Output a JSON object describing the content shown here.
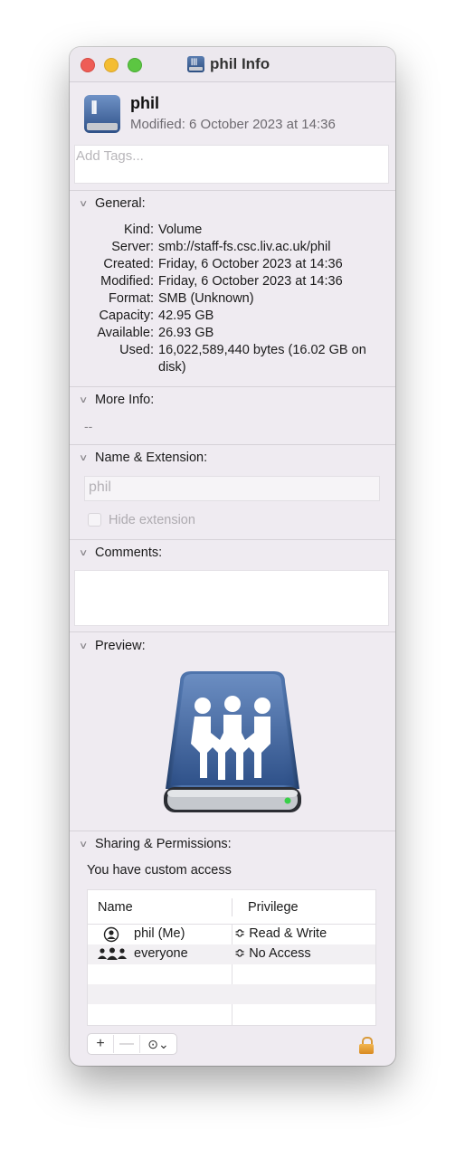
{
  "window": {
    "title": "phil Info"
  },
  "header": {
    "name": "phil",
    "modified": "Modified: 6 October 2023 at 14:36",
    "tags_placeholder": "Add Tags..."
  },
  "general": {
    "heading": "General:",
    "rows": [
      {
        "key": "Kind:",
        "value": "Volume"
      },
      {
        "key": "Server:",
        "value": "smb://staff-fs.csc.liv.ac.uk/phil"
      },
      {
        "key": "Created:",
        "value": "Friday, 6 October 2023 at 14:36"
      },
      {
        "key": "Modified:",
        "value": "Friday, 6 October 2023 at 14:36"
      },
      {
        "key": "Format:",
        "value": "SMB (Unknown)"
      },
      {
        "key": "Capacity:",
        "value": "42.95 GB"
      },
      {
        "key": "Available:",
        "value": "26.93 GB"
      },
      {
        "key": "Used:",
        "value": "16,022,589,440 bytes (16.02 GB on disk)"
      }
    ]
  },
  "more_info": {
    "heading": "More Info:",
    "value": "--"
  },
  "name_ext": {
    "heading": "Name & Extension:",
    "name_value": "phil",
    "hide_extension_label": "Hide extension"
  },
  "comments": {
    "heading": "Comments:"
  },
  "preview": {
    "heading": "Preview:"
  },
  "sharing": {
    "heading": "Sharing & Permissions:",
    "access_text": "You have custom access",
    "col_name": "Name",
    "col_privilege": "Privilege",
    "rows": [
      {
        "name": "phil (Me)",
        "privilege": "Read & Write",
        "icon": "user-icon"
      },
      {
        "name": "everyone",
        "privilege": "No Access",
        "icon": "group-icon"
      }
    ],
    "add_label": "+",
    "remove_label": "—",
    "action_label": "⊙⌄"
  },
  "colors": {
    "window_bg": "#efebf1",
    "volume_blue": "#3c5f97",
    "lock_orange": "#e5a03a"
  }
}
